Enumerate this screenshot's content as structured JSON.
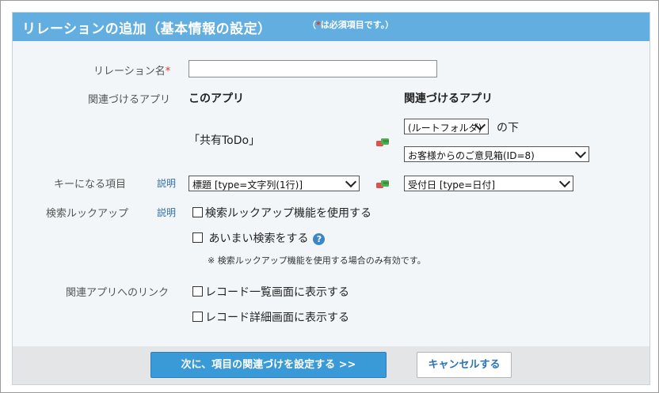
{
  "header": {
    "title": "リレーションの追加（基本情報の設定）",
    "note_open": "（",
    "note_star": "*",
    "note_rest": "は必須項目です。）"
  },
  "form": {
    "relation_name": {
      "label": "リレーション名",
      "required_mark": "*",
      "value": ""
    },
    "related_app": {
      "label": "関連づけるアプリ",
      "this_app_heading": "このアプリ",
      "related_app_heading": "関連づけるアプリ",
      "this_app_name": "「共有ToDo」",
      "folder_select": "(ルートフォルダ)",
      "folder_suffix": "の下",
      "app_select": "お客様からのご意見箱(ID=8)"
    },
    "key_field": {
      "label": "キーになる項目",
      "help_link": "説明",
      "this_field_select": "標題 [type=文字列(1行)]",
      "related_field_select": "受付日 [type=日付]"
    },
    "lookup": {
      "label": "検索ルックアップ",
      "help_link": "説明",
      "use_lookup_label": "検索ルックアップ機能を使用する",
      "fuzzy_label": "あいまい検索をする",
      "help_icon": "?",
      "note": "※ 検索ルックアップ機能を使用する場合のみ有効です。"
    },
    "links": {
      "label": "関連アプリへのリンク",
      "list_view_label": "レコード一覧画面に表示する",
      "detail_view_label": "レコード詳細画面に表示する"
    }
  },
  "footer": {
    "next_button": "次に、項目の関連づけを設定する >>",
    "cancel_button": "キャンセルする"
  },
  "icons": {
    "link": "link-icon",
    "help": "help-icon"
  },
  "colors": {
    "header": "#62aee0",
    "primary_button": "#3a9ad8",
    "required": "#e0302a",
    "link": "#2f6ea8"
  }
}
